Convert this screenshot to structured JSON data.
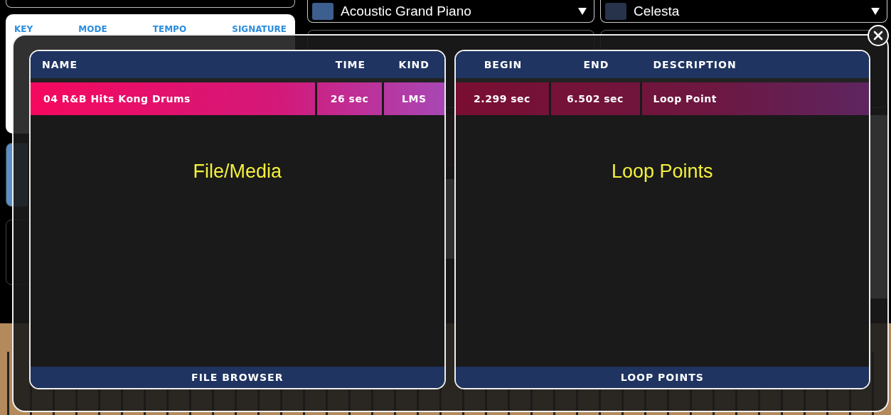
{
  "header_panel": {
    "labels": [
      "KEY",
      "MODE",
      "TEMPO",
      "SIGNATURE"
    ]
  },
  "instruments": [
    {
      "name": "Acoustic Grand Piano",
      "color": "#3d5f8f"
    },
    {
      "name": "Celesta",
      "color": "#26334a"
    }
  ],
  "overlay": {
    "panels": [
      {
        "kind": "files",
        "caption": "File/Media",
        "footer": "FILE BROWSER",
        "columns": [
          "NAME",
          "TIME",
          "KIND"
        ],
        "rows": [
          {
            "cells": [
              "04 R&B Hits Kong Drums",
              "26 sec",
              "LMS"
            ],
            "selected": true
          }
        ]
      },
      {
        "kind": "loops",
        "caption": "Loop Points",
        "footer": "LOOP POINTS",
        "columns": [
          "BEGIN",
          "END",
          "DESCRIPTION"
        ],
        "rows": [
          {
            "cells": [
              "2.299 sec",
              "6.502 sec",
              "Loop Point"
            ],
            "selected": true
          }
        ]
      }
    ]
  }
}
